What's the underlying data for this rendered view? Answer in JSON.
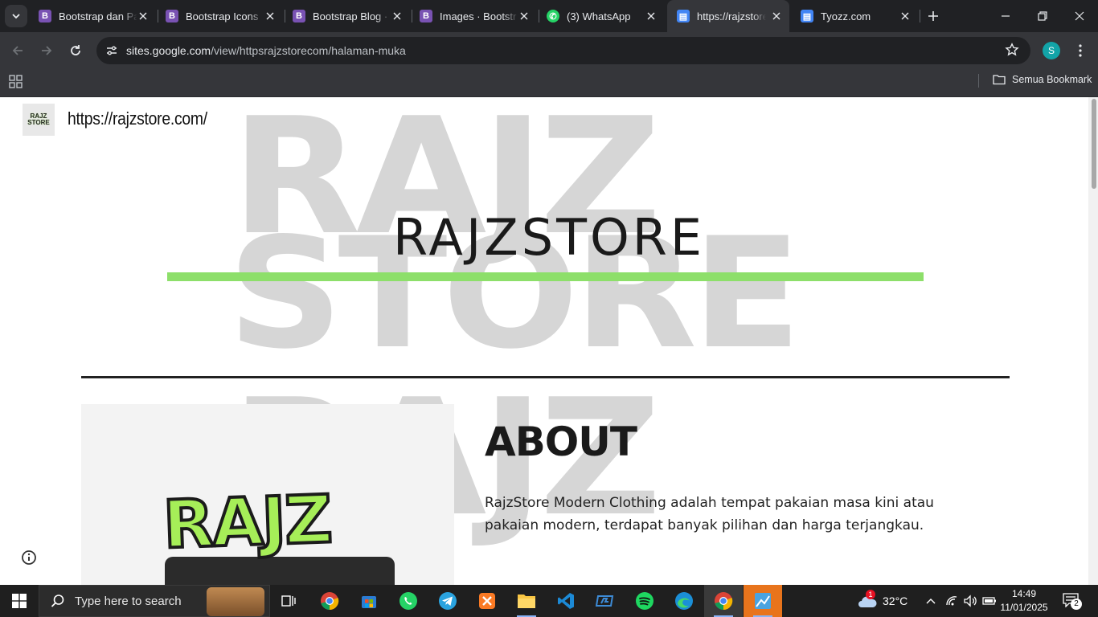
{
  "browser": {
    "tabs": [
      {
        "title": "Bootstrap dan Pa",
        "favicon": "bootstrap-icon",
        "color": "#7952b3"
      },
      {
        "title": "Bootstrap Icons",
        "favicon": "bootstrap-icon",
        "color": "#7952b3"
      },
      {
        "title": "Bootstrap Blog ·",
        "favicon": "bootstrap-icon",
        "color": "#7952b3"
      },
      {
        "title": "Images · Bootstr",
        "favicon": "bootstrap-icon",
        "color": "#7952b3"
      },
      {
        "title": "(3) WhatsApp",
        "favicon": "whatsapp-icon",
        "color": "#25d366"
      },
      {
        "title": "https://rajzstore",
        "favicon": "google-sites-icon",
        "color": "#4285f4"
      },
      {
        "title": "Tyozz.com",
        "favicon": "google-sites-icon",
        "color": "#4285f4"
      }
    ],
    "active_tab_index": 5,
    "url_host": "sites.google.com",
    "url_path": "/view/httpsrajzstorecom/halaman-muka",
    "profile_initial": "S",
    "bookmarks_label": "Semua Bookmark"
  },
  "page": {
    "site_name": "https://rajzstore.com/",
    "logo_text_top": "RAJZ",
    "logo_text_bottom": "STORE",
    "watermark_top": "RAJZ",
    "watermark_bottom": "STORE",
    "hero_title": "RAJZSTORE",
    "about_title": "ABOUT",
    "about_text": "RajzStore Modern Clothing adalah tempat pakaian masa kini atau pakaian modern, terdapat banyak pilihan dan harga terjangkau.",
    "about_image_text": "RAJZ",
    "accent_color": "#8ddf6a"
  },
  "taskbar": {
    "search_placeholder": "Type here to search",
    "weather": "32°C",
    "weather_badge": "1",
    "time": "14:49",
    "date": "11/01/2025",
    "notification_count": "2"
  }
}
